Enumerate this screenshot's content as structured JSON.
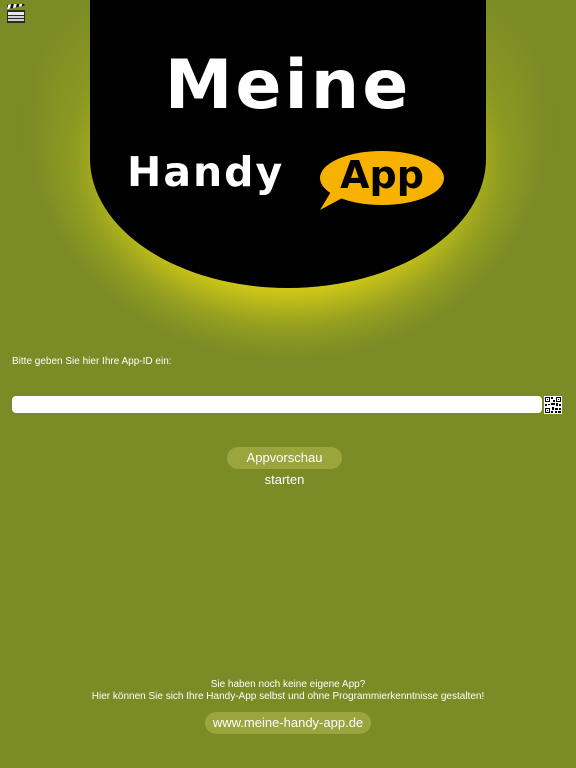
{
  "icons": {
    "clapper": "clapperboard-icon",
    "qr": "qr-code-icon"
  },
  "colors": {
    "background": "#7b8b26",
    "button": "#9aa53d",
    "logo_black": "#000000",
    "logo_glow": "#ffee19",
    "bubble": "#f7b200"
  },
  "logo": {
    "line1": "Meine",
    "line2": "Handy",
    "bubble": "App"
  },
  "form": {
    "prompt": "Bitte geben Sie hier Ihre App-ID ein:",
    "input_value": ""
  },
  "start_button": {
    "label": "Appvorschau starten"
  },
  "footer": {
    "line1": "Sie haben noch keine eigene App?",
    "line2": "Hier können Sie sich Ihre Handy-App selbst und ohne Programmierkenntnisse gestalten!",
    "link_label": "www.meine-handy-app.de"
  }
}
